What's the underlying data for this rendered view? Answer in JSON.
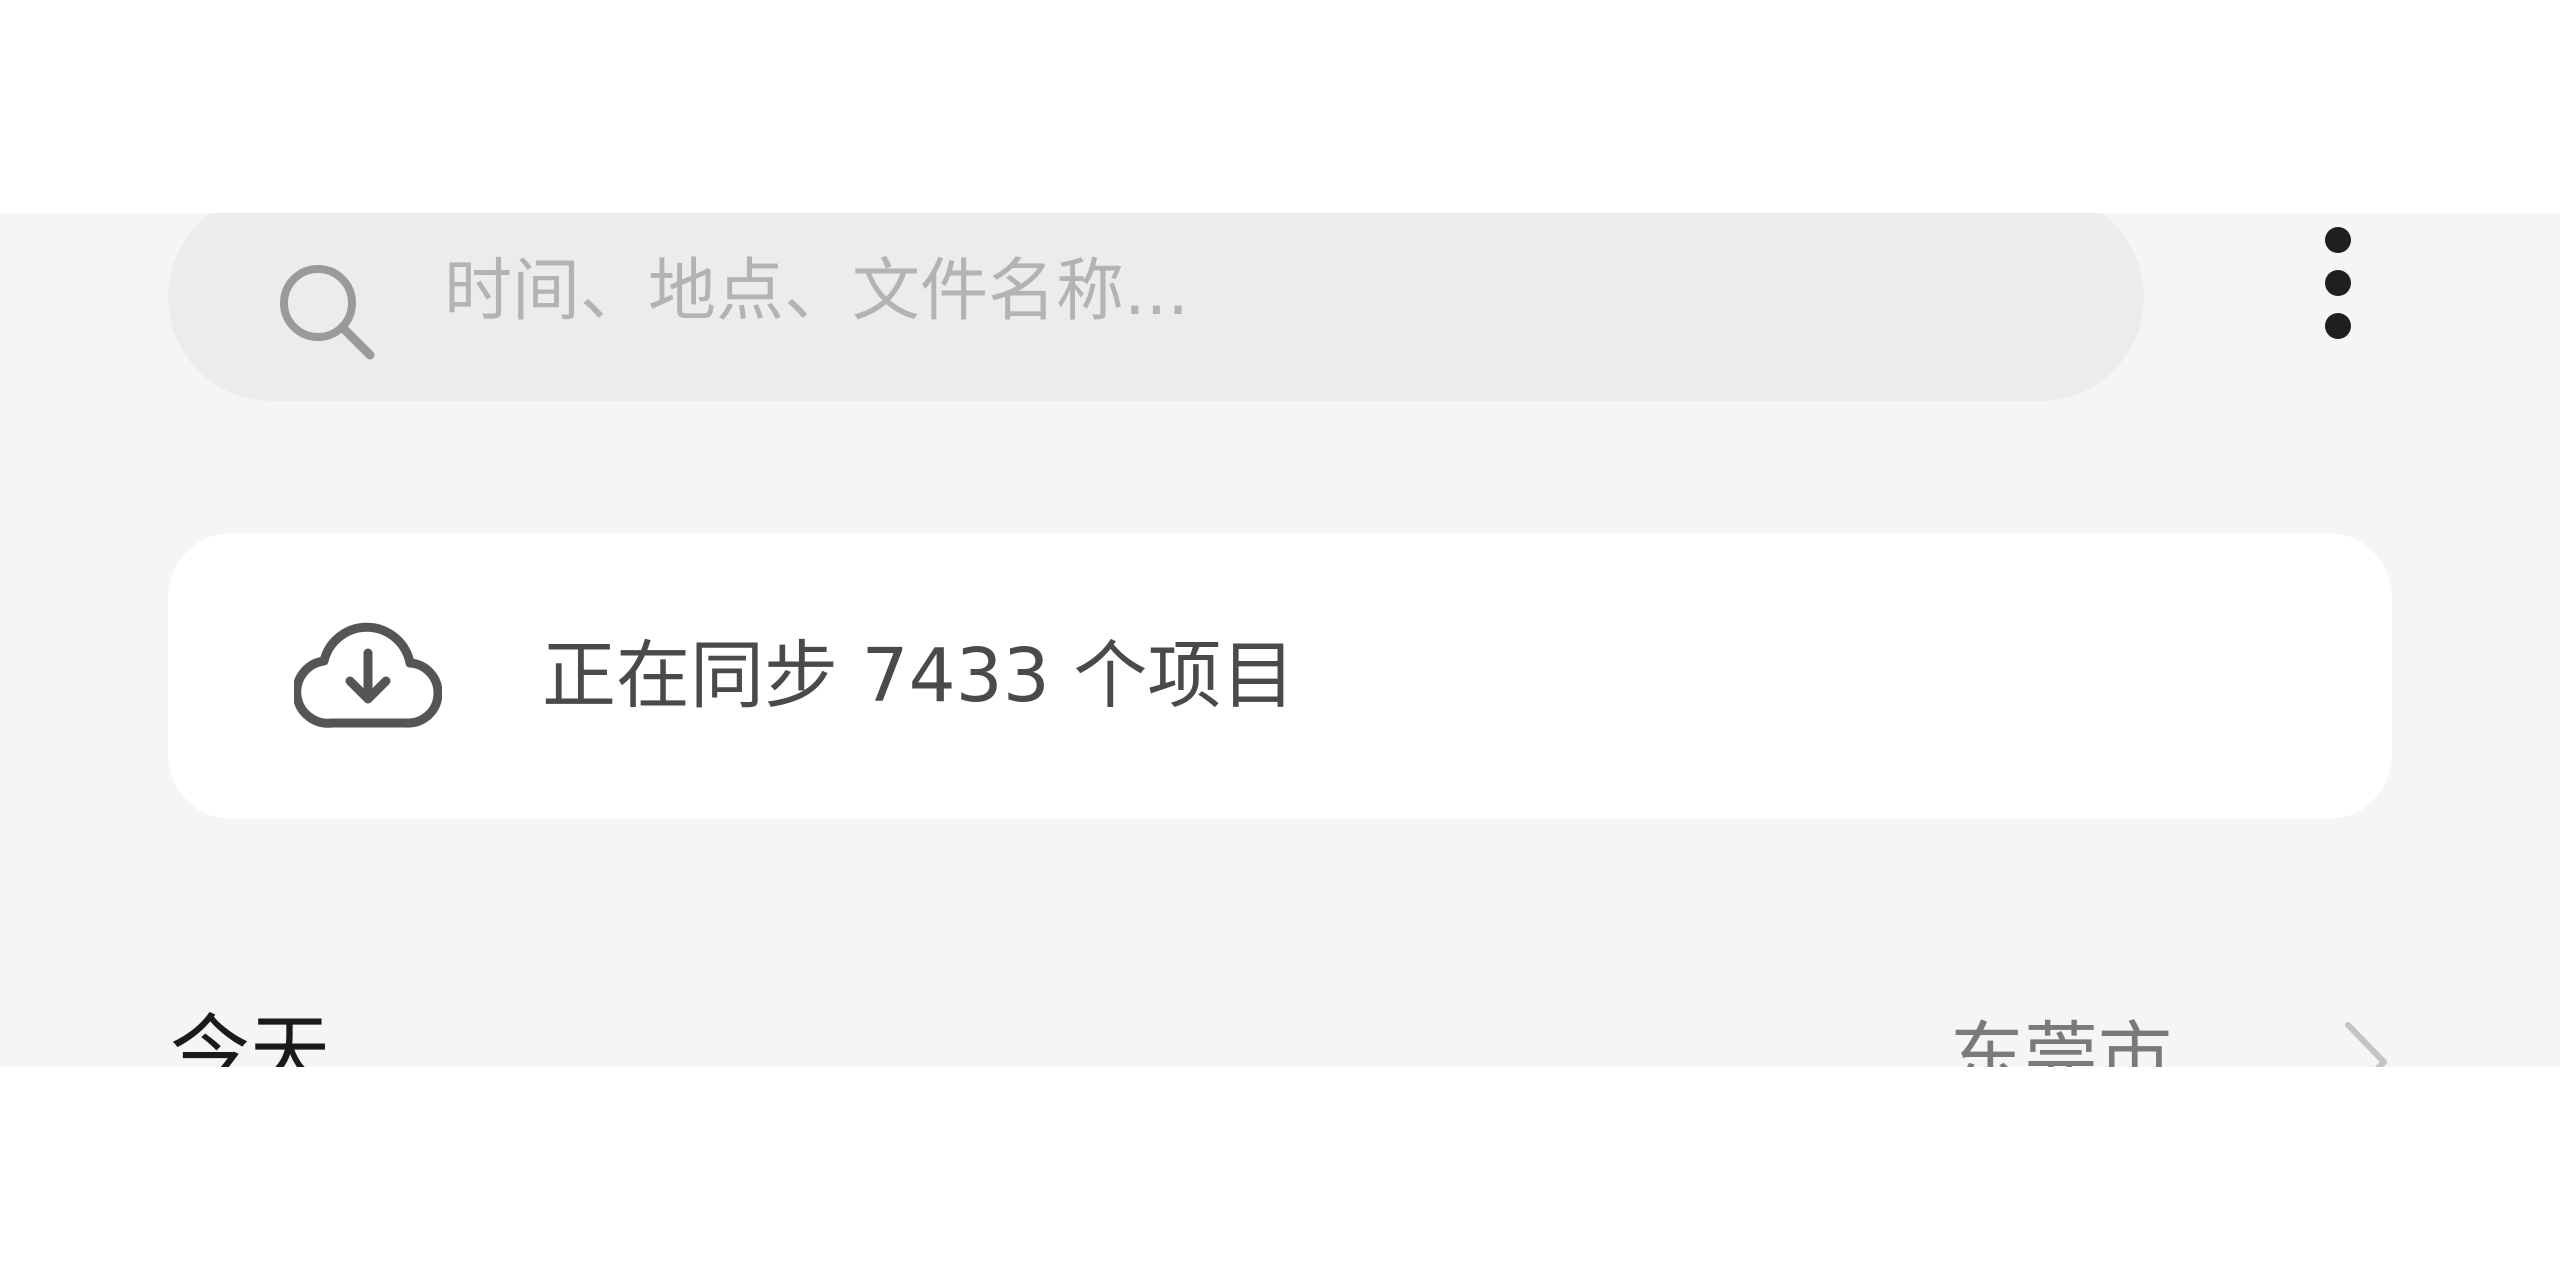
{
  "search": {
    "placeholder": "时间、地点、文件名称..."
  },
  "sync": {
    "status_text": "正在同步 7433 个项目"
  },
  "section": {
    "title": "今天",
    "location": "东莞市"
  },
  "icons": {
    "search": "search-icon",
    "more": "more-vertical-icon",
    "cloud": "cloud-download-icon",
    "chevron": "chevron-right-icon"
  },
  "colors": {
    "background": "#f5f5f5",
    "search_bar": "#ececec",
    "card": "#ffffff",
    "placeholder": "#b3b3b3",
    "text_primary": "#1a1a1a",
    "text_secondary": "#4a4a4a"
  }
}
